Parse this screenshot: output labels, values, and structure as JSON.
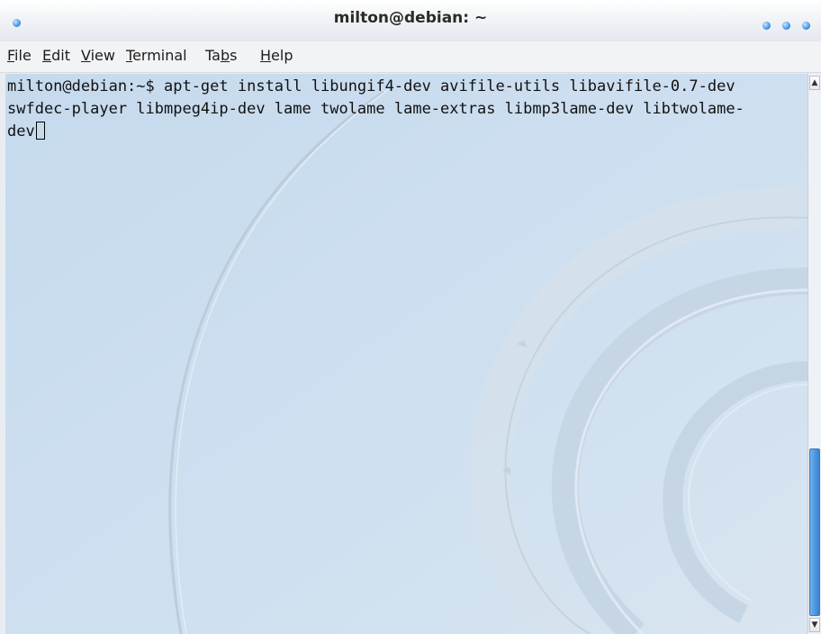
{
  "window": {
    "title": "milton@debian: ~"
  },
  "menu": {
    "items": [
      {
        "mnemonic": "F",
        "rest": "ile"
      },
      {
        "mnemonic": "E",
        "rest": "dit"
      },
      {
        "mnemonic": "V",
        "rest": "iew"
      },
      {
        "mnemonic": "T",
        "rest": "erminal"
      },
      {
        "pre": "Ta",
        "mnemonic": "b",
        "rest": "s"
      },
      {
        "mnemonic": "H",
        "rest": "elp"
      }
    ]
  },
  "terminal": {
    "lines": [
      "milton@debian:~$ apt-get install libungif4-dev avifile-utils libavifile-0.7-dev",
      "swfdec-player libmpeg4ip-dev lame twolame lame-extras libmp3lame-dev libtwolame-",
      "dev"
    ],
    "background_colors": [
      "#c8dcef",
      "#d7e4f0"
    ]
  },
  "scrollbar": {
    "position_fraction": 1.0,
    "visible_fraction": 0.32,
    "accent_color": "#4a94df"
  },
  "icons": {
    "window_menu": "window-menu-icon",
    "buttons": [
      "minimize-icon",
      "maximize-icon",
      "close-icon"
    ],
    "scroll_up": "scroll-up-arrow-icon",
    "scroll_down": "scroll-down-arrow-icon"
  }
}
